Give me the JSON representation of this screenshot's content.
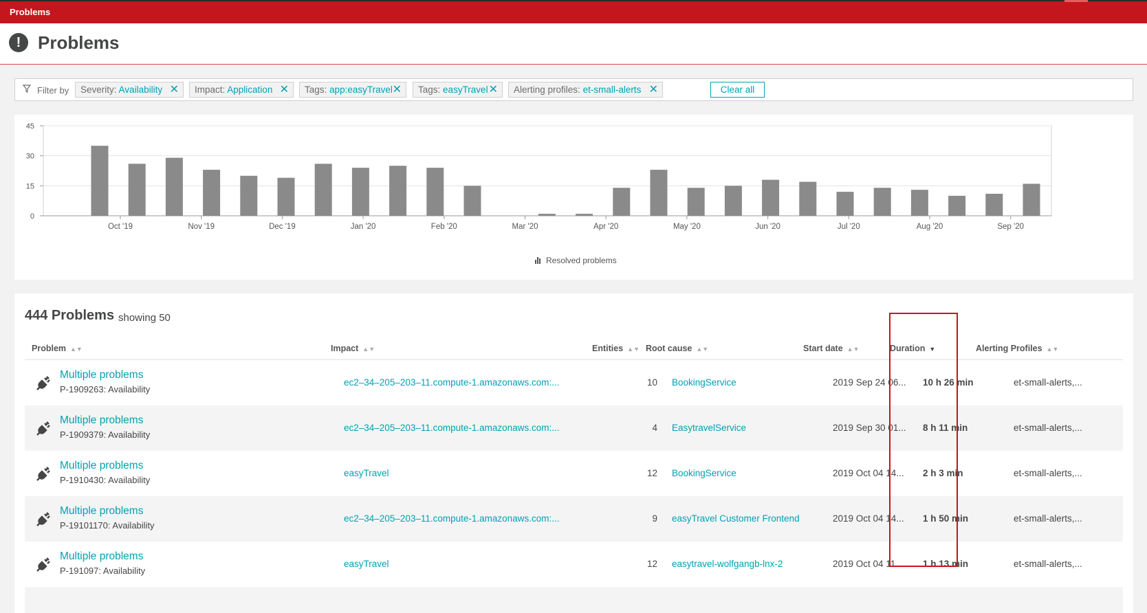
{
  "app": {
    "breadcrumb": "Problems",
    "page_title": "Problems"
  },
  "filter": {
    "label": "Filter by",
    "chips": [
      {
        "key": "Severity:",
        "value": "Availability"
      },
      {
        "key": "Impact:",
        "value": "Application"
      },
      {
        "key": "Tags:",
        "value": "app:easyTravel"
      },
      {
        "key": "Tags:",
        "value": "easyTravel"
      },
      {
        "key": "Alerting profiles:",
        "value": "et-small-alerts"
      }
    ],
    "clear_all": "Clear all"
  },
  "chart_data": {
    "type": "bar",
    "ylim": [
      0,
      45
    ],
    "yticks": [
      0,
      15,
      30,
      45
    ],
    "xtick_labels": [
      "Oct '19",
      "Nov '19",
      "Dec '19",
      "Jan '20",
      "Feb '20",
      "Mar '20",
      "Apr '20",
      "May '20",
      "Jun '20",
      "Jul '20",
      "Aug '20",
      "Sep '20"
    ],
    "series": [
      {
        "name": "Resolved problems",
        "values": [
          35,
          26,
          29,
          23,
          20,
          19,
          26,
          24,
          25,
          24,
          15,
          0,
          1,
          1,
          14,
          23,
          14,
          15,
          18,
          17,
          12,
          14,
          13,
          10,
          11,
          16
        ]
      }
    ],
    "color": "#8a8a8a"
  },
  "table": {
    "count_label": "444 Problems",
    "showing_label": "showing 50",
    "columns": [
      "Problem",
      "Impact",
      "Entities",
      "Root cause",
      "Start date",
      "Duration",
      "Alerting Profiles"
    ],
    "rows": [
      {
        "title": "Multiple problems",
        "id": "P-1909263: Availability",
        "impact": "ec2–34–205–203–11.compute-1.amazonaws.com:...",
        "entities": "10",
        "root_cause": "BookingService",
        "start": "2019 Sep 24 06...",
        "duration": "10 h 26 min",
        "alerting": "et-small-alerts,..."
      },
      {
        "title": "Multiple problems",
        "id": "P-1909379: Availability",
        "impact": "ec2–34–205–203–11.compute-1.amazonaws.com:...",
        "entities": "4",
        "root_cause": "EasytravelService",
        "start": "2019 Sep 30 01...",
        "duration": "8 h 11 min",
        "alerting": "et-small-alerts,..."
      },
      {
        "title": "Multiple problems",
        "id": "P-1910430: Availability",
        "impact": "easyTravel",
        "entities": "12",
        "root_cause": "BookingService",
        "start": "2019 Oct 04 14...",
        "duration": "2 h 3 min",
        "alerting": "et-small-alerts,..."
      },
      {
        "title": "Multiple problems",
        "id": "P-19101170: Availability",
        "impact": "ec2–34–205–203–11.compute-1.amazonaws.com:...",
        "entities": "9",
        "root_cause": "easyTravel Customer Frontend",
        "start": "2019 Oct 04 14...",
        "duration": "1 h 50 min",
        "alerting": "et-small-alerts,..."
      },
      {
        "title": "Multiple problems",
        "id": "P-191097: Availability",
        "impact": "easyTravel",
        "entities": "12",
        "root_cause": "easytravel-wolfgangb-lnx-2",
        "start": "2019 Oct 04 11...",
        "duration": "1 h 13 min",
        "alerting": "et-small-alerts,..."
      }
    ]
  },
  "icons": {
    "header": "exclamation-icon",
    "filter": "filter-funnel-icon",
    "row": "plug-disconnected-icon"
  }
}
